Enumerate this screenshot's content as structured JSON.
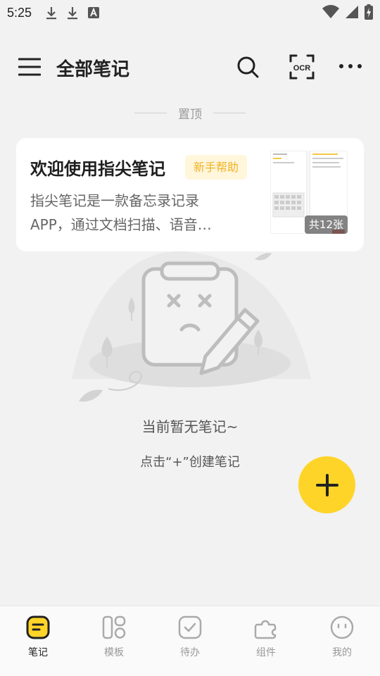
{
  "status_bar": {
    "time": "5:25",
    "left_icons": [
      "download-icon",
      "download-icon",
      "font-app-icon"
    ],
    "right_icons": [
      "wifi-icon",
      "signal-icon",
      "battery-charging-icon"
    ]
  },
  "header": {
    "title": "全部笔记",
    "menu_icon": "hamburger-menu-icon",
    "search_icon": "search-icon",
    "ocr_label": "OCR",
    "more_icon": "more-horizontal-icon"
  },
  "pinned": {
    "label": "置顶"
  },
  "note_card": {
    "title": "欢迎使用指尖笔记",
    "badge": "新手帮助",
    "preview_line1": "指尖笔记是一款备忘录记录",
    "preview_line2": "APP，通过文档扫描、语音…",
    "image_count": "共12张"
  },
  "empty_state": {
    "message": "当前暂无笔记~",
    "hint": "点击“+”创建笔记"
  },
  "fab": {
    "icon": "plus-icon"
  },
  "bottom_nav": {
    "items": [
      {
        "label": "笔记",
        "icon": "notes-icon",
        "active": true
      },
      {
        "label": "模板",
        "icon": "template-icon",
        "active": false
      },
      {
        "label": "待办",
        "icon": "todo-check-icon",
        "active": false
      },
      {
        "label": "组件",
        "icon": "widget-icon",
        "active": false
      },
      {
        "label": "我的",
        "icon": "profile-face-icon",
        "active": false
      }
    ]
  },
  "colors": {
    "accent": "#ffd429",
    "background": "#f2f2f2",
    "badge_text": "#f0b324",
    "badge_bg": "#fff6dc"
  }
}
